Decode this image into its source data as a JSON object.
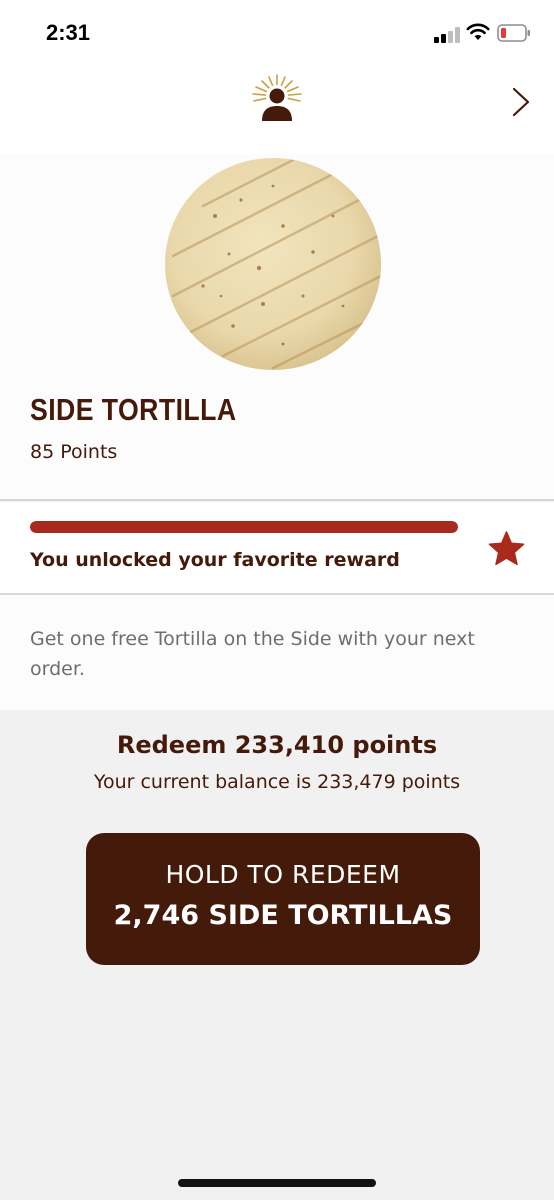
{
  "status_bar": {
    "time": "2:31"
  },
  "header": {
    "logo_icon": "sunburst-person-logo",
    "next_icon": "chevron-right-icon"
  },
  "item": {
    "image_icon": "tortilla-image",
    "title": "SIDE TORTILLA",
    "points": "85 Points"
  },
  "progress": {
    "value": 1.0,
    "message": "You unlocked your favorite reward",
    "icon": "star-icon"
  },
  "description": "Get one free Tortilla on the Side with your next order.",
  "redeem": {
    "title": "Redeem 233,410 points",
    "balance": "Your current balance is 233,479 points",
    "button_line1": "HOLD TO REDEEM",
    "button_line2": "2,746 SIDE TORTILLAS"
  },
  "colors": {
    "brand_brown": "#441a0a",
    "progress_red": "#a82a1d",
    "logo_gold": "#c9a044",
    "background": "#f1f1f1"
  }
}
